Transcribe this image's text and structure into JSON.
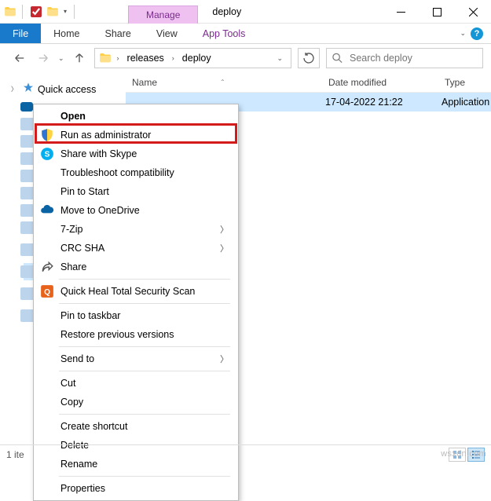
{
  "titlebar": {
    "manage_label": "Manage",
    "window_title": "deploy"
  },
  "ribbon": {
    "file": "File",
    "home": "Home",
    "share": "Share",
    "view": "View",
    "apptools": "App Tools"
  },
  "address": {
    "crumb1": "releases",
    "crumb2": "deploy"
  },
  "search": {
    "placeholder": "Search deploy"
  },
  "navpane": {
    "quick_access": "Quick access"
  },
  "columns": {
    "name": "Name",
    "date": "Date modified",
    "type": "Type"
  },
  "file_row": {
    "date": "17-04-2022 21:22",
    "type": "Application"
  },
  "context_menu": {
    "open": "Open",
    "run_admin": "Run as administrator",
    "share_skype": "Share with Skype",
    "troubleshoot": "Troubleshoot compatibility",
    "pin_start": "Pin to Start",
    "move_onedrive": "Move to OneDrive",
    "seven_zip": "7-Zip",
    "crc_sha": "CRC SHA",
    "share": "Share",
    "quickheal": "Quick Heal Total Security Scan",
    "pin_taskbar": "Pin to taskbar",
    "restore_prev": "Restore previous versions",
    "send_to": "Send to",
    "cut": "Cut",
    "copy": "Copy",
    "create_shortcut": "Create shortcut",
    "delete": "Delete",
    "rename": "Rename",
    "properties": "Properties"
  },
  "statusbar": {
    "count": "1 ite"
  },
  "watermark": "wsxdn.com"
}
